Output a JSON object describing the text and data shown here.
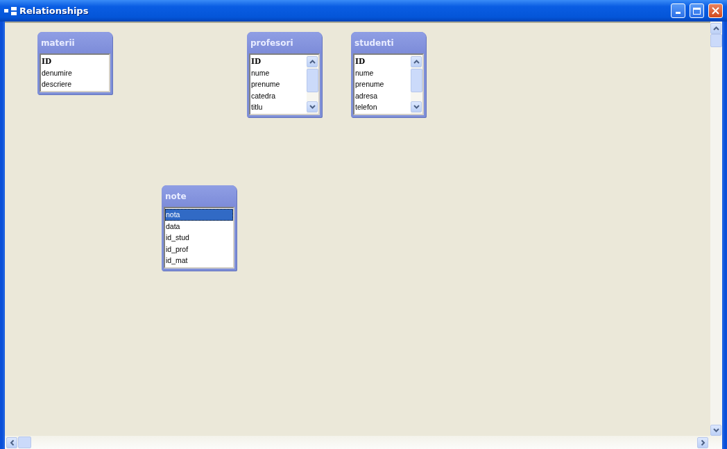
{
  "window": {
    "title": "Relationships"
  },
  "tables": [
    {
      "name": "materii",
      "scrollable": false,
      "fields": [
        {
          "name": "ID",
          "primary_key": true,
          "selected": false
        },
        {
          "name": "denumire",
          "primary_key": false,
          "selected": false
        },
        {
          "name": "descriere",
          "primary_key": false,
          "selected": false
        }
      ]
    },
    {
      "name": "profesori",
      "scrollable": true,
      "fields": [
        {
          "name": "ID",
          "primary_key": true,
          "selected": false
        },
        {
          "name": "nume",
          "primary_key": false,
          "selected": false
        },
        {
          "name": "prenume",
          "primary_key": false,
          "selected": false
        },
        {
          "name": "catedra",
          "primary_key": false,
          "selected": false
        },
        {
          "name": "titlu",
          "primary_key": false,
          "selected": false
        }
      ]
    },
    {
      "name": "studenti",
      "scrollable": true,
      "fields": [
        {
          "name": "ID",
          "primary_key": true,
          "selected": false
        },
        {
          "name": "nume",
          "primary_key": false,
          "selected": false
        },
        {
          "name": "prenume",
          "primary_key": false,
          "selected": false
        },
        {
          "name": "adresa",
          "primary_key": false,
          "selected": false
        },
        {
          "name": "telefon",
          "primary_key": false,
          "selected": false
        }
      ]
    },
    {
      "name": "note",
      "scrollable": false,
      "fields": [
        {
          "name": "nota",
          "primary_key": false,
          "selected": true
        },
        {
          "name": "data",
          "primary_key": false,
          "selected": false
        },
        {
          "name": "id_stud",
          "primary_key": false,
          "selected": false
        },
        {
          "name": "id_prof",
          "primary_key": false,
          "selected": false
        },
        {
          "name": "id_mat",
          "primary_key": false,
          "selected": false
        }
      ]
    }
  ]
}
